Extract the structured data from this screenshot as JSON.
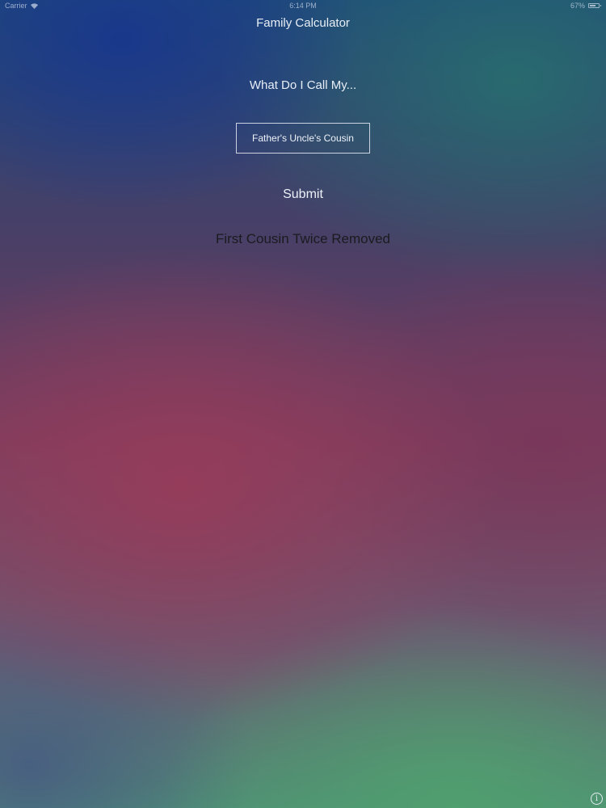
{
  "status_bar": {
    "carrier": "Carrier",
    "time": "6:14 PM",
    "battery_text": "67%",
    "battery_level": 0.67
  },
  "app": {
    "title": "Family Calculator",
    "prompt": "What Do I Call My...",
    "input_value": "Father's Uncle's Cousin",
    "submit_label": "Submit",
    "result": "First Cousin Twice Removed",
    "info_glyph": "i"
  },
  "icons": {
    "wifi": "wifi-icon",
    "battery": "battery-icon",
    "info": "info-icon"
  },
  "colors": {
    "text": "#e8eef6",
    "result_text": "#1b1b1f",
    "input_border": "#e6ebf5"
  }
}
